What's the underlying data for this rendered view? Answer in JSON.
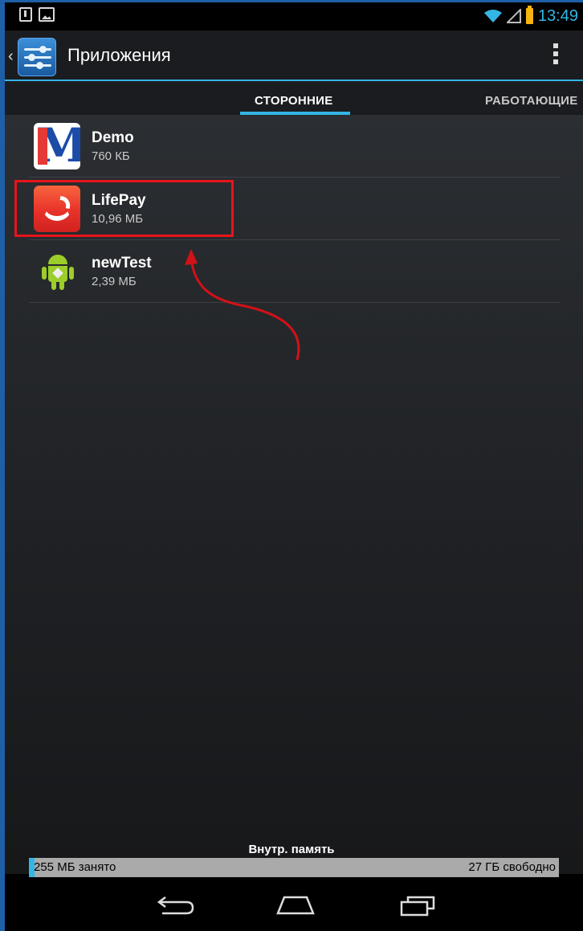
{
  "status_bar": {
    "time": "13:49"
  },
  "action_bar": {
    "title": "Приложения"
  },
  "tabs": [
    {
      "label": "СТОРОННИЕ",
      "active": true
    },
    {
      "label": "РАБОТАЮЩИЕ",
      "active": false
    }
  ],
  "apps": [
    {
      "name": "Demo",
      "size": "760 КБ",
      "icon": "demo-m-icon"
    },
    {
      "name": "LifePay",
      "size": "10,96 МБ",
      "icon": "lifepay-icon"
    },
    {
      "name": "newTest",
      "size": "2,39 МБ",
      "icon": "android-icon"
    }
  ],
  "storage": {
    "label": "Внутр. память",
    "used_text": "255 МБ занято",
    "free_text": "27 ГБ свободно",
    "used_fraction": 0.01
  },
  "colors": {
    "accent": "#33b5e5",
    "highlight": "#e8141b",
    "battery": "#f6b40e"
  }
}
